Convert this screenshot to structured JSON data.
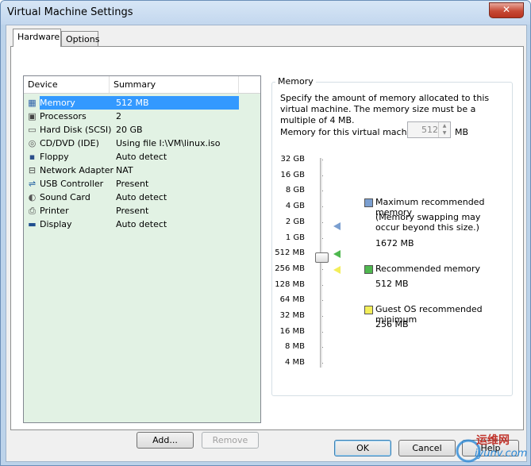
{
  "window": {
    "title": "Virtual Machine Settings",
    "close_glyph": "✕"
  },
  "tabs": [
    {
      "label": "Hardware",
      "active": true
    },
    {
      "label": "Options",
      "active": false
    }
  ],
  "device_list": {
    "headers": {
      "device": "Device",
      "summary": "Summary"
    },
    "rows": [
      {
        "device": "Memory",
        "summary": "512 MB",
        "icon": "memory-icon",
        "glyph": "▦",
        "color": "#2b5fa8",
        "selected": true
      },
      {
        "device": "Processors",
        "summary": "2",
        "icon": "processor-icon",
        "glyph": "▣",
        "color": "#444444"
      },
      {
        "device": "Hard Disk (SCSI)",
        "summary": "20 GB",
        "icon": "hard-disk-icon",
        "glyph": "▭",
        "color": "#555555"
      },
      {
        "device": "CD/DVD (IDE)",
        "summary": "Using file I:\\VM\\linux.iso",
        "icon": "cd-dvd-icon",
        "glyph": "◎",
        "color": "#555555"
      },
      {
        "device": "Floppy",
        "summary": "Auto detect",
        "icon": "floppy-icon",
        "glyph": "▪",
        "color": "#2b4f8a"
      },
      {
        "device": "Network Adapter",
        "summary": "NAT",
        "icon": "network-adapter-icon",
        "glyph": "⊟",
        "color": "#444444"
      },
      {
        "device": "USB Controller",
        "summary": "Present",
        "icon": "usb-controller-icon",
        "glyph": "⇌",
        "color": "#1f5fa0"
      },
      {
        "device": "Sound Card",
        "summary": "Auto detect",
        "icon": "sound-card-icon",
        "glyph": "◐",
        "color": "#555555"
      },
      {
        "device": "Printer",
        "summary": "Present",
        "icon": "printer-icon",
        "glyph": "⎙",
        "color": "#444444"
      },
      {
        "device": "Display",
        "summary": "Auto detect",
        "icon": "display-icon",
        "glyph": "▬",
        "color": "#1f4f8f"
      }
    ],
    "add_label": "Add...",
    "remove_label": "Remove"
  },
  "memory": {
    "group_title": "Memory",
    "description": "Specify the amount of memory allocated to this virtual machine. The memory size must be a multiple of 4 MB.",
    "field_label": "Memory for this virtual machine:",
    "field_value": "512",
    "field_unit": "MB",
    "scale_labels": [
      "32 GB",
      "16 GB",
      "8 GB",
      "4 GB",
      "2 GB",
      "1 GB",
      "512 MB",
      "256 MB",
      "128 MB",
      "64 MB",
      "32 MB",
      "16 MB",
      "8 MB",
      "4 MB"
    ],
    "current_value": "512 MB",
    "legend": {
      "max": {
        "title": "Maximum recommended memory",
        "note": "(Memory swapping may occur beyond this size.)",
        "value": "1672 MB",
        "color": "#7b9fd0"
      },
      "recommended": {
        "title": "Recommended memory",
        "value": "512 MB",
        "color": "#4fb84f"
      },
      "guest_min": {
        "title": "Guest OS recommended minimum",
        "value": "256 MB",
        "color": "#f3ee5a"
      }
    }
  },
  "footer": {
    "ok_label": "OK",
    "cancel_label": "Cancel",
    "help_label": "Help"
  },
  "watermark": {
    "text": "运维网",
    "sub": "iyunv.com"
  }
}
